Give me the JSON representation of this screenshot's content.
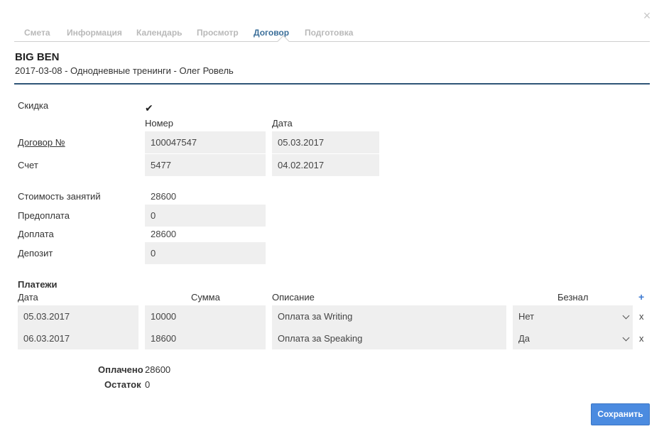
{
  "close_icon": "×",
  "tabs": [
    {
      "label": "Смета"
    },
    {
      "label": "Информация"
    },
    {
      "label": "Календарь"
    },
    {
      "label": "Просмотр"
    },
    {
      "label": "Договор"
    },
    {
      "label": "Подготовка"
    }
  ],
  "active_tab": "Договор",
  "header": {
    "title": "BIG BEN",
    "subtitle": "2017-03-08 - Однодневные тренинги - Олег Ровель"
  },
  "discount": {
    "label": "Скидка",
    "checked": true,
    "check_glyph": "✔"
  },
  "columns": {
    "number": "Номер",
    "date": "Дата"
  },
  "contract": {
    "label": "Договор №",
    "number": "100047547",
    "date": "05.03.2017"
  },
  "invoice": {
    "label": "Счет",
    "number": "5477",
    "date": "04.02.2017"
  },
  "costs": {
    "cost_label": "Стоимость занятий",
    "cost_value": "28600",
    "prepay_label": "Предоплата",
    "prepay_value": "0",
    "surcharge_label": "Доплата",
    "surcharge_value": "28600",
    "deposit_label": "Депозит",
    "deposit_value": "0"
  },
  "payments": {
    "title": "Платежи",
    "headers": {
      "date": "Дата",
      "sum": "Сумма",
      "description": "Описание",
      "cashless": "Безнал"
    },
    "add_label": "+",
    "delete_label": "x",
    "rows": [
      {
        "date": "05.03.2017",
        "sum": "10000",
        "description": "Оплата за Writing",
        "cashless": "Нет"
      },
      {
        "date": "06.03.2017",
        "sum": "18600",
        "description": "Оплата за Speaking",
        "cashless": "Да"
      }
    ]
  },
  "totals": {
    "paid_label": "Оплачено",
    "paid_value": "28600",
    "rest_label": "Остаток",
    "rest_value": "0"
  },
  "save_label": "Сохранить",
  "colors": {
    "accent": "#3a6e99",
    "title_line": "#2f5577",
    "button": "#4b8be0",
    "field_bg": "#efefef"
  }
}
